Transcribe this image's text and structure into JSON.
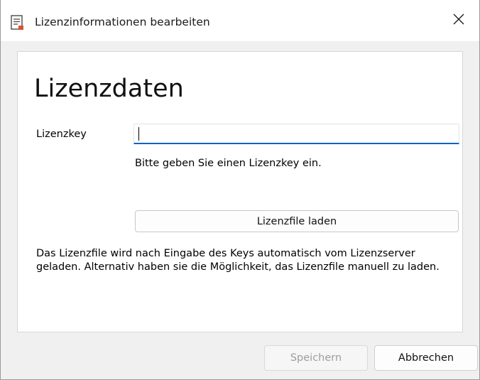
{
  "window": {
    "title": "Lizenzinformationen bearbeiten",
    "icon": "document-edit-icon",
    "close_glyph": "✕"
  },
  "panel": {
    "heading": "Lizenzdaten",
    "license_key": {
      "label": "Lizenzkey",
      "value": "",
      "placeholder": ""
    },
    "hint": "Bitte geben Sie einen Lizenzkey ein.",
    "load_button_label": "Lizenzfile laden",
    "description": "Das Lizenzfile wird nach Eingabe des Keys automatisch vom Lizenzserver geladen. Alternativ haben sie die Möglichkeit, das Lizenzfile manuell zu laden."
  },
  "footer": {
    "save_label": "Speichern",
    "cancel_label": "Abbrechen"
  },
  "colors": {
    "accent": "#0a64c6",
    "disabled_text": "#9d9d9d"
  }
}
